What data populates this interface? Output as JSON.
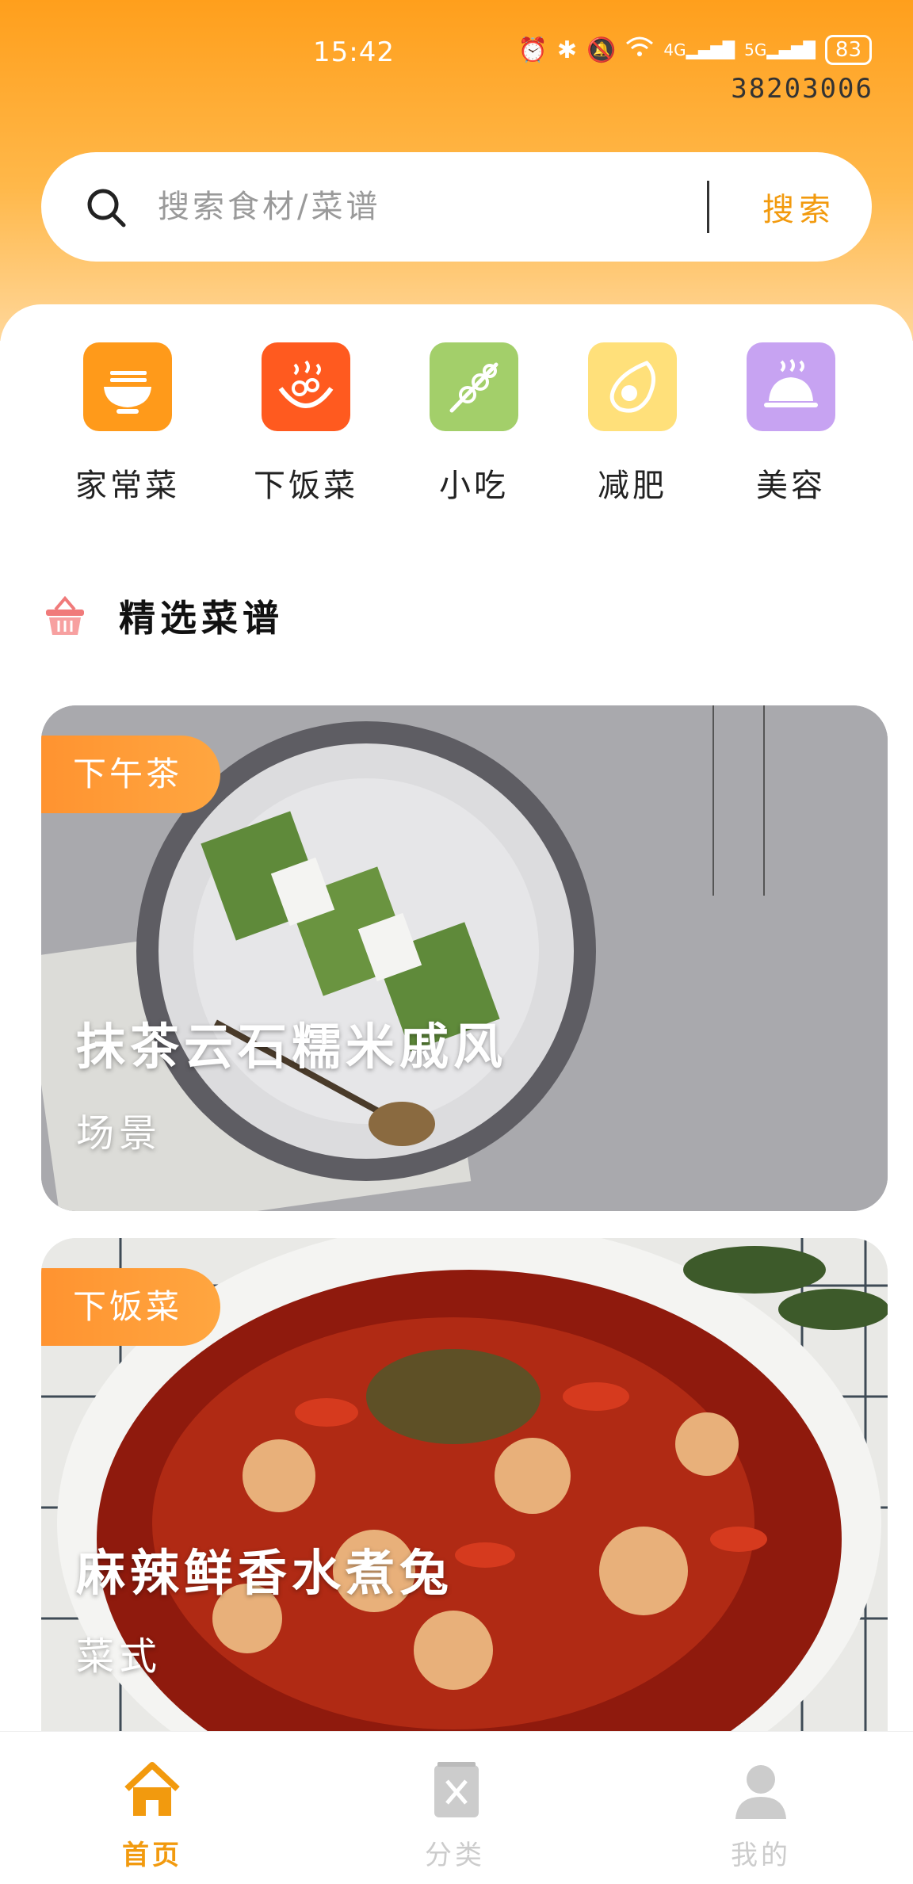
{
  "status_bar": {
    "time": "15:42",
    "battery": "83",
    "network_1": "4G",
    "network_2": "5G",
    "device_id": "38203006"
  },
  "search": {
    "placeholder": "搜索食材/菜谱",
    "button_label": "搜索"
  },
  "categories": [
    {
      "label": "家常菜",
      "icon": "noodle-bowl-icon",
      "color": "#ff9a1a"
    },
    {
      "label": "下饭菜",
      "icon": "chili-dish-icon",
      "color": "#ff5a1f"
    },
    {
      "label": "小吃",
      "icon": "skewer-icon",
      "color": "#a3cf6a"
    },
    {
      "label": "减肥",
      "icon": "avocado-icon",
      "color": "#ffe07a"
    },
    {
      "label": "美容",
      "icon": "cloche-icon",
      "color": "#c7a3f2"
    }
  ],
  "section": {
    "title": "精选菜谱",
    "icon": "basket-icon"
  },
  "recipes": [
    {
      "tag": "下午茶",
      "title": "抹茶云石糯米戚风",
      "subtitle": "场景"
    },
    {
      "tag": "下饭菜",
      "title": "麻辣鲜香水煮兔",
      "subtitle": "菜式"
    }
  ],
  "nav": [
    {
      "label": "首页",
      "icon": "home-icon",
      "active": true
    },
    {
      "label": "分类",
      "icon": "category-book-icon",
      "active": false
    },
    {
      "label": "我的",
      "icon": "user-icon",
      "active": false
    }
  ],
  "colors": {
    "accent": "#ff9f1c",
    "active_nav": "#f29a0e",
    "inactive_nav": "#cccccc"
  }
}
